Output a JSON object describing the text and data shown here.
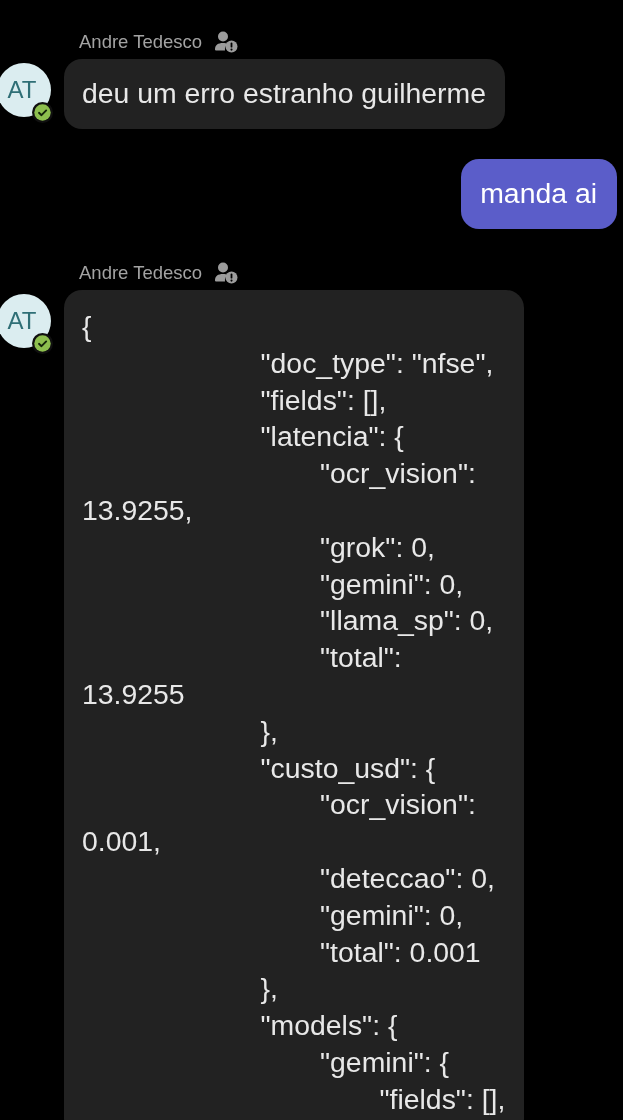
{
  "messages": [
    {
      "kind": "incoming",
      "sender": "Andre Tedesco",
      "external": true,
      "avatar": {
        "initials": "AT",
        "available": true
      },
      "text": "deu um erro estranho guilherme"
    },
    {
      "kind": "outgoing",
      "text": "manda ai"
    },
    {
      "kind": "incoming",
      "sender": "Andre Tedesco",
      "external": true,
      "avatar": {
        "initials": "AT",
        "available": true
      },
      "text": "{\n\t\t\t\"doc_type\": \"nfse\",\n\t\t\t\"fields\": [],\n\t\t\t\"latencia\": {\n\t\t\t\t\"ocr_vision\":\n13.9255,\n\t\t\t\t\"grok\": 0,\n\t\t\t\t\"gemini\": 0,\n\t\t\t\t\"llama_sp\": 0,\n\t\t\t\t\"total\":\n13.9255\n\t\t\t},\n\t\t\t\"custo_usd\": {\n\t\t\t\t\"ocr_vision\":\n0.001,\n\t\t\t\t\"deteccao\": 0,\n\t\t\t\t\"gemini\": 0,\n\t\t\t\t\"total\": 0.001\n\t\t\t},\n\t\t\t\"models\": {\n\t\t\t\t\"gemini\": {\n\t\t\t\t\t\"fields\": [],"
    }
  ]
}
